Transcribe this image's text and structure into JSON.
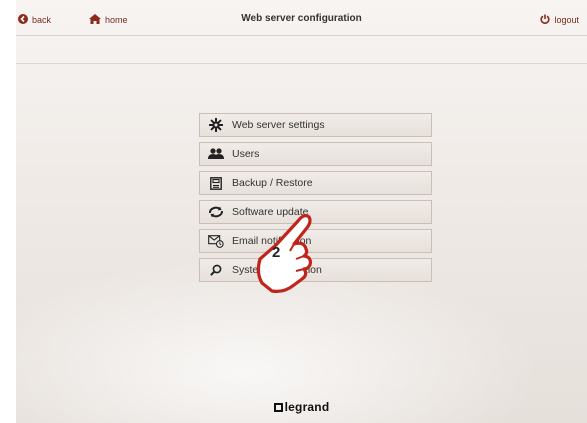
{
  "header": {
    "back_label": "back",
    "home_label": "home",
    "title": "Web server configuration",
    "logout_label": "logout"
  },
  "menu": {
    "items": [
      {
        "label": "Web server settings",
        "icon": "gear-icon"
      },
      {
        "label": "Users",
        "icon": "users-icon"
      },
      {
        "label": "Backup / Restore",
        "icon": "backup-icon"
      },
      {
        "label": "Software update",
        "icon": "software-update-icon"
      },
      {
        "label": "Email notification",
        "icon": "email-notification-icon"
      },
      {
        "label": "System information",
        "icon": "search-icon"
      }
    ]
  },
  "callout": {
    "step": "2"
  },
  "footer": {
    "logo_text": "legrand"
  },
  "colors": {
    "accent": "#7a2a1e",
    "hand": "#c0251c"
  }
}
